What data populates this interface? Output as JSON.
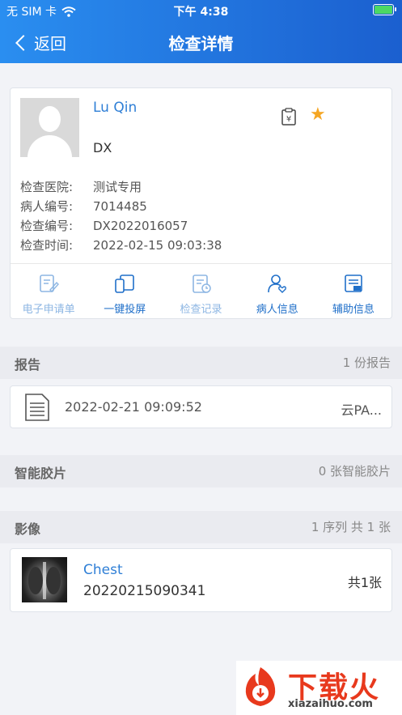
{
  "status_bar": {
    "carrier": "无 SIM 卡",
    "time": "下午 4:38"
  },
  "nav": {
    "back_label": "返回",
    "title": "检查详情"
  },
  "patient": {
    "name": "Lu Qin",
    "modality": "DX",
    "fields": [
      {
        "label": "检查医院:",
        "value": "测试专用"
      },
      {
        "label": "病人编号:",
        "value": "7014485"
      },
      {
        "label": "检查编号:",
        "value": "DX2022016057"
      },
      {
        "label": "检查时间:",
        "value": "2022-02-15 09:03:38"
      }
    ]
  },
  "actions": [
    {
      "label": "电子申请单",
      "icon": "application-form-icon"
    },
    {
      "label": "一键投屏",
      "icon": "screen-cast-icon"
    },
    {
      "label": "检查记录",
      "icon": "exam-record-icon"
    },
    {
      "label": "病人信息",
      "icon": "patient-info-icon"
    },
    {
      "label": "辅助信息",
      "icon": "aux-info-icon"
    }
  ],
  "sections": {
    "report": {
      "title": "报告",
      "summary": "1 份报告"
    },
    "film": {
      "title": "智能胶片",
      "summary": "0 张智能胶片"
    },
    "imaging": {
      "title": "影像",
      "summary": "1 序列 共 1 张"
    }
  },
  "report_item": {
    "date": "2022-02-21 09:09:52",
    "source": "云PA..."
  },
  "image_item": {
    "series_name": "Chest",
    "series_number": "20220215090341",
    "count": "共1张"
  },
  "watermark": {
    "text": "下载火",
    "url": "xiazaihuo.com"
  },
  "colors": {
    "header_start": "#2a8ef0",
    "header_end": "#1b5fcf",
    "accent": "#2f7fd6",
    "star": "#f5a623"
  }
}
